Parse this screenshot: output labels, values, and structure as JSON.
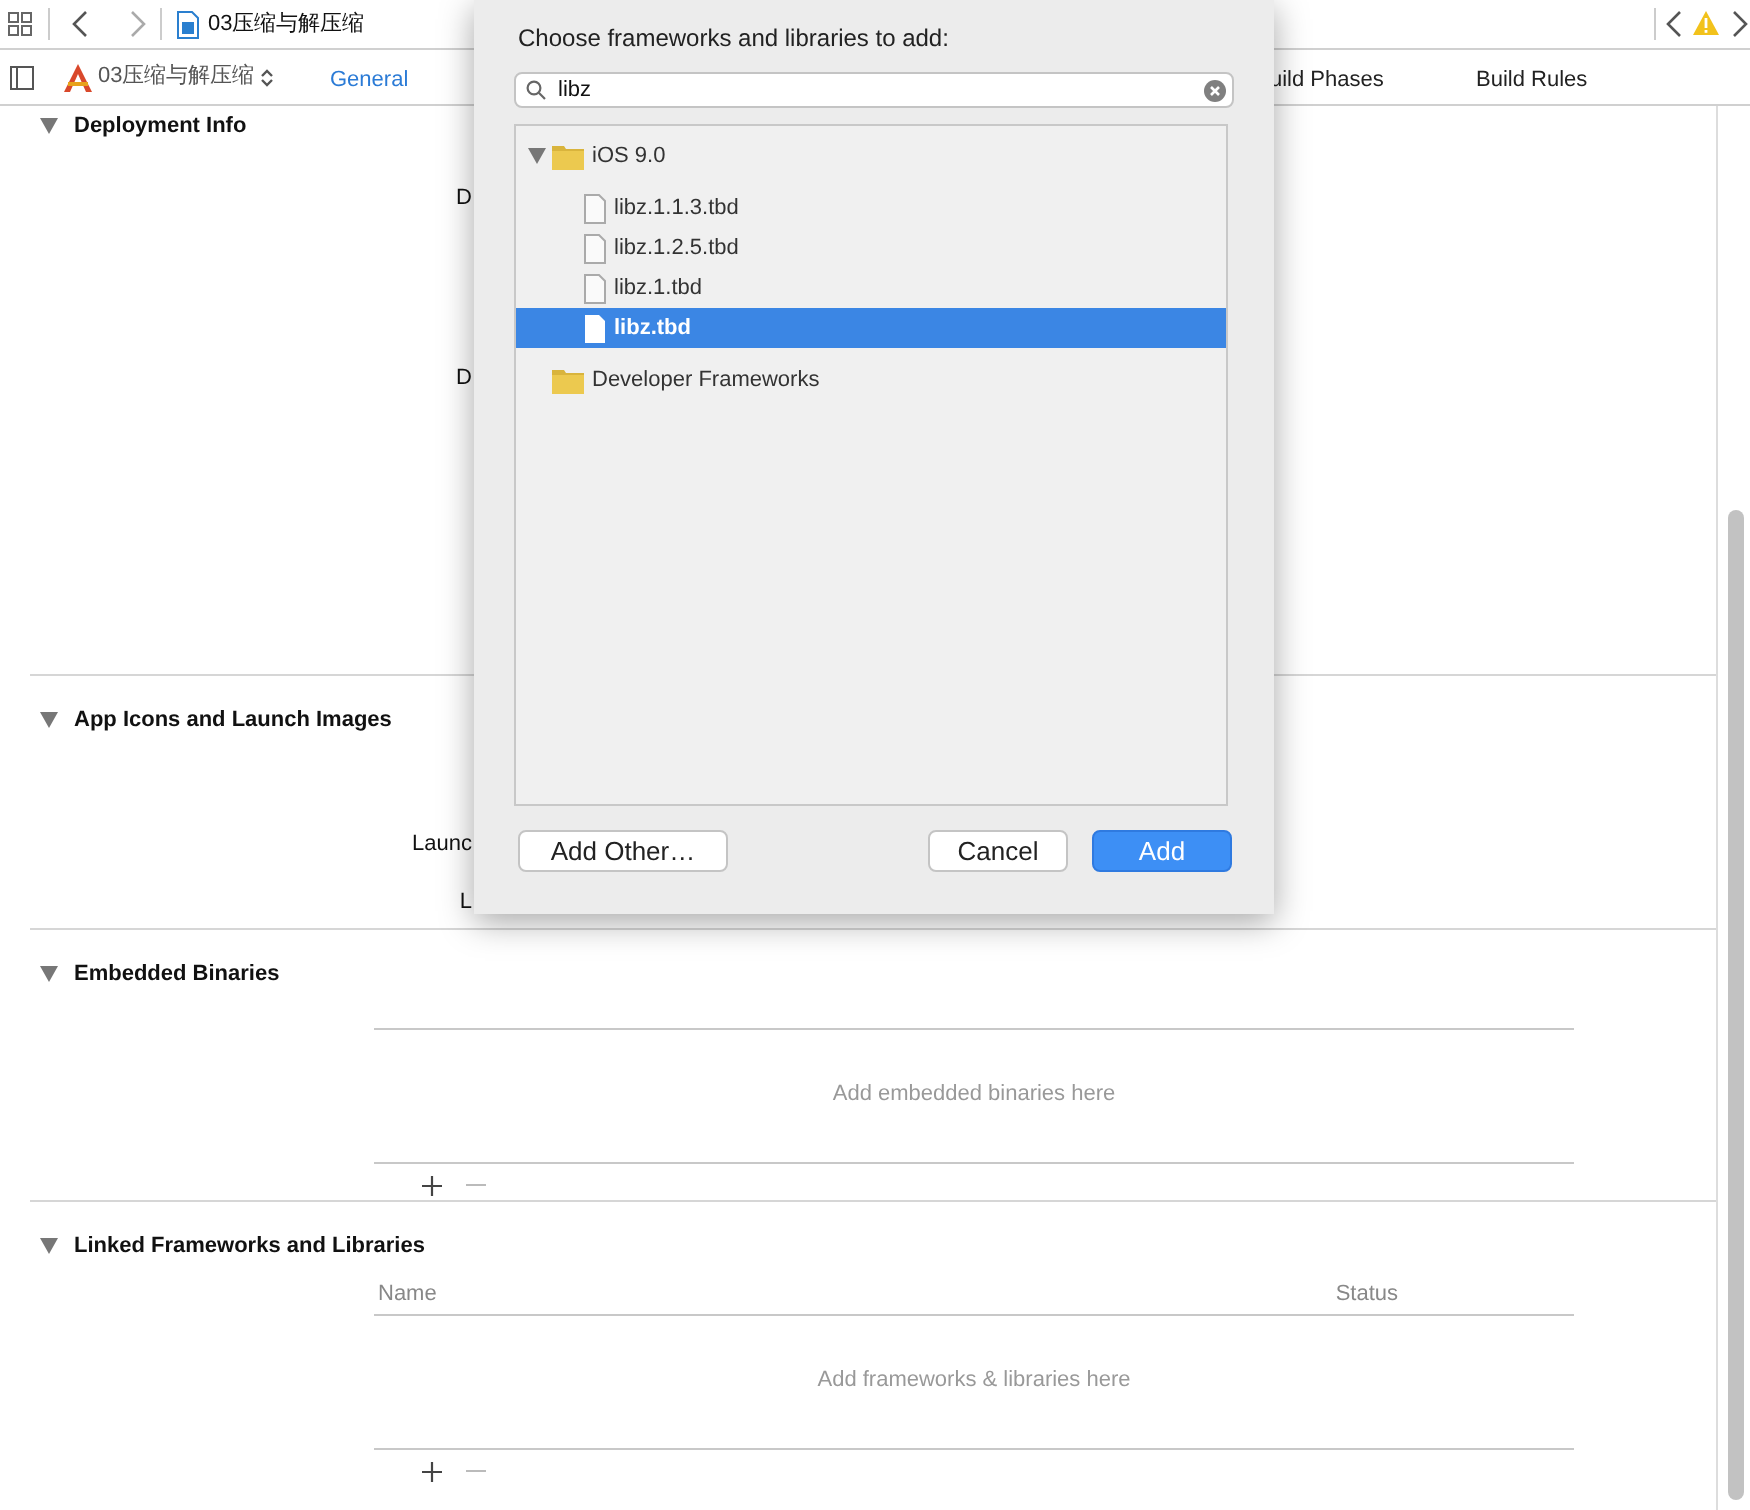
{
  "window": {
    "title": "03压缩与解压缩"
  },
  "target_bar": {
    "target": "03压缩与解压缩",
    "tabs": [
      {
        "label": "General",
        "selected": true
      },
      {
        "label": "uild Phases",
        "selected": false
      },
      {
        "label": "Build Rules",
        "selected": false
      }
    ]
  },
  "sections": [
    {
      "title": "Deployment Info",
      "expanded": true,
      "kind": "fields",
      "fields": [
        "D",
        "D"
      ]
    },
    {
      "title": "App Icons and Launch Images",
      "expanded": true,
      "kind": "fields",
      "fields": [
        "Launc",
        "L"
      ]
    },
    {
      "title": "Embedded Binaries",
      "expanded": true,
      "kind": "table",
      "empty_text": "Add embedded binaries here"
    },
    {
      "title": "Linked Frameworks and Libraries",
      "expanded": true,
      "kind": "table",
      "columns": [
        "Name",
        "Status"
      ],
      "empty_text": "Add frameworks & libraries here"
    }
  ],
  "sheet": {
    "title": "Choose frameworks and libraries to add:",
    "search": {
      "value": "libz"
    },
    "tree": [
      {
        "label": "iOS 9.0",
        "kind": "folder",
        "selected": false,
        "expanded": true,
        "children": [
          {
            "label": "libz.1.1.3.tbd",
            "kind": "file",
            "selected": false
          },
          {
            "label": "libz.1.2.5.tbd",
            "kind": "file",
            "selected": false
          },
          {
            "label": "libz.1.tbd",
            "kind": "file",
            "selected": false
          },
          {
            "label": "libz.tbd",
            "kind": "file",
            "selected": true
          }
        ]
      },
      {
        "label": "Developer Frameworks",
        "kind": "folder",
        "selected": false
      }
    ],
    "buttons": [
      {
        "label": "Add Other…",
        "kind": "plain"
      },
      {
        "label": "Cancel",
        "kind": "plain"
      },
      {
        "label": "Add",
        "kind": "default"
      }
    ]
  }
}
